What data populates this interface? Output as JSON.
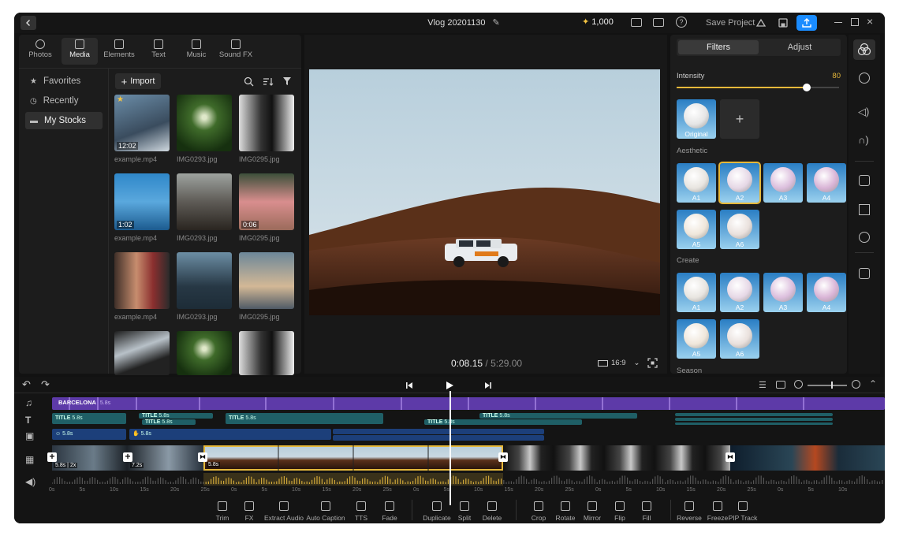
{
  "app": {
    "project_title": "Vlog 20201130",
    "credits": "1,000",
    "save_project": "Save Project"
  },
  "media_tabs": [
    {
      "label": "Photos",
      "icon": "photos-icon"
    },
    {
      "label": "Media",
      "icon": "media-icon"
    },
    {
      "label": "Elements",
      "icon": "elements-icon"
    },
    {
      "label": "Text",
      "icon": "text-icon"
    },
    {
      "label": "Music",
      "icon": "music-icon"
    },
    {
      "label": "Sound FX",
      "icon": "sound-fx-icon"
    }
  ],
  "sidebar": {
    "items": [
      {
        "label": "Favorites",
        "icon": "star-icon"
      },
      {
        "label": "Recently",
        "icon": "clock-icon"
      },
      {
        "label": "My Stocks",
        "icon": "folder-icon"
      }
    ]
  },
  "import_label": "Import",
  "media_items": [
    {
      "name": "example.mp4",
      "duration": "12:02",
      "favorite": true
    },
    {
      "name": "IMG0293.jpg",
      "duration": ""
    },
    {
      "name": "IMG0295.jpg",
      "duration": ""
    },
    {
      "name": "example.mp4",
      "duration": "1:02"
    },
    {
      "name": "IMG0293.jpg",
      "duration": ""
    },
    {
      "name": "IMG0295.jpg",
      "duration": "0:06"
    },
    {
      "name": "example.mp4",
      "duration": ""
    },
    {
      "name": "IMG0293.jpg",
      "duration": ""
    },
    {
      "name": "IMG0295.jpg",
      "duration": ""
    },
    {
      "name": "",
      "duration": ""
    },
    {
      "name": "",
      "duration": ""
    },
    {
      "name": "",
      "duration": ""
    }
  ],
  "preview": {
    "current_time": "0:08.15",
    "total_time": "5:29.00",
    "aspect": "16:9"
  },
  "filters": {
    "tabs": [
      "Filters",
      "Adjust"
    ],
    "intensity_label": "Intensity",
    "intensity_value": "80",
    "intensity_fraction": 0.8,
    "original_label": "Original",
    "sections": [
      {
        "title": "Aesthetic",
        "items": [
          "A1",
          "A2",
          "A3",
          "A4",
          "A5",
          "A6"
        ],
        "selected": "A2"
      },
      {
        "title": "Create",
        "items": [
          "A1",
          "A2",
          "A3",
          "A4",
          "A5",
          "A6"
        ]
      },
      {
        "title": "Season",
        "items": []
      }
    ]
  },
  "timeline": {
    "music_clip": "BARCELONA",
    "music_clip_dur": "5.8s",
    "title_clips": [
      "TITLE",
      "TITLE",
      "TITLE",
      "TITLE",
      "TITLE",
      "TITLE"
    ],
    "title_dur": "5.8s",
    "overlay_dur": "5.8s",
    "video_clip_labels": [
      "5.8s | 2x",
      "7.2s",
      "5.8s"
    ],
    "ruler": [
      "0s",
      "5s",
      "10s",
      "15s",
      "20s",
      "25s",
      "0s",
      "5s",
      "10s",
      "15s",
      "20s",
      "25s",
      "0s",
      "5s",
      "10s",
      "15s",
      "20s",
      "25s",
      "0s",
      "5s",
      "10s",
      "15s",
      "20s",
      "25s",
      "0s",
      "5s",
      "10s"
    ]
  },
  "tools": [
    {
      "label": "Trim",
      "icon": "trim-icon"
    },
    {
      "label": "FX",
      "icon": "fx-icon"
    },
    {
      "label": "Extract Audio",
      "icon": "extract-audio-icon"
    },
    {
      "label": "Auto Caption",
      "icon": "auto-caption-icon"
    },
    {
      "label": "TTS",
      "icon": "tts-icon"
    },
    {
      "label": "Fade",
      "icon": "fade-icon"
    },
    {
      "label": "Duplicate",
      "icon": "duplicate-icon"
    },
    {
      "label": "Split",
      "icon": "split-icon"
    },
    {
      "label": "Delete",
      "icon": "delete-icon"
    },
    {
      "label": "Crop",
      "icon": "crop-icon"
    },
    {
      "label": "Rotate",
      "icon": "rotate-icon"
    },
    {
      "label": "Mirror",
      "icon": "mirror-icon"
    },
    {
      "label": "Flip",
      "icon": "flip-icon"
    },
    {
      "label": "Fill",
      "icon": "fill-icon"
    },
    {
      "label": "Reverse",
      "icon": "reverse-icon"
    },
    {
      "label": "Freeze",
      "icon": "freeze-icon"
    },
    {
      "label": "PIP Track",
      "icon": "pip-track-icon"
    }
  ],
  "colors": {
    "accent": "#1a8cff",
    "highlight": "#e6b83a",
    "music": "#6a3fb8",
    "title": "#1f5f66",
    "overlay": "#1c3f7a"
  }
}
